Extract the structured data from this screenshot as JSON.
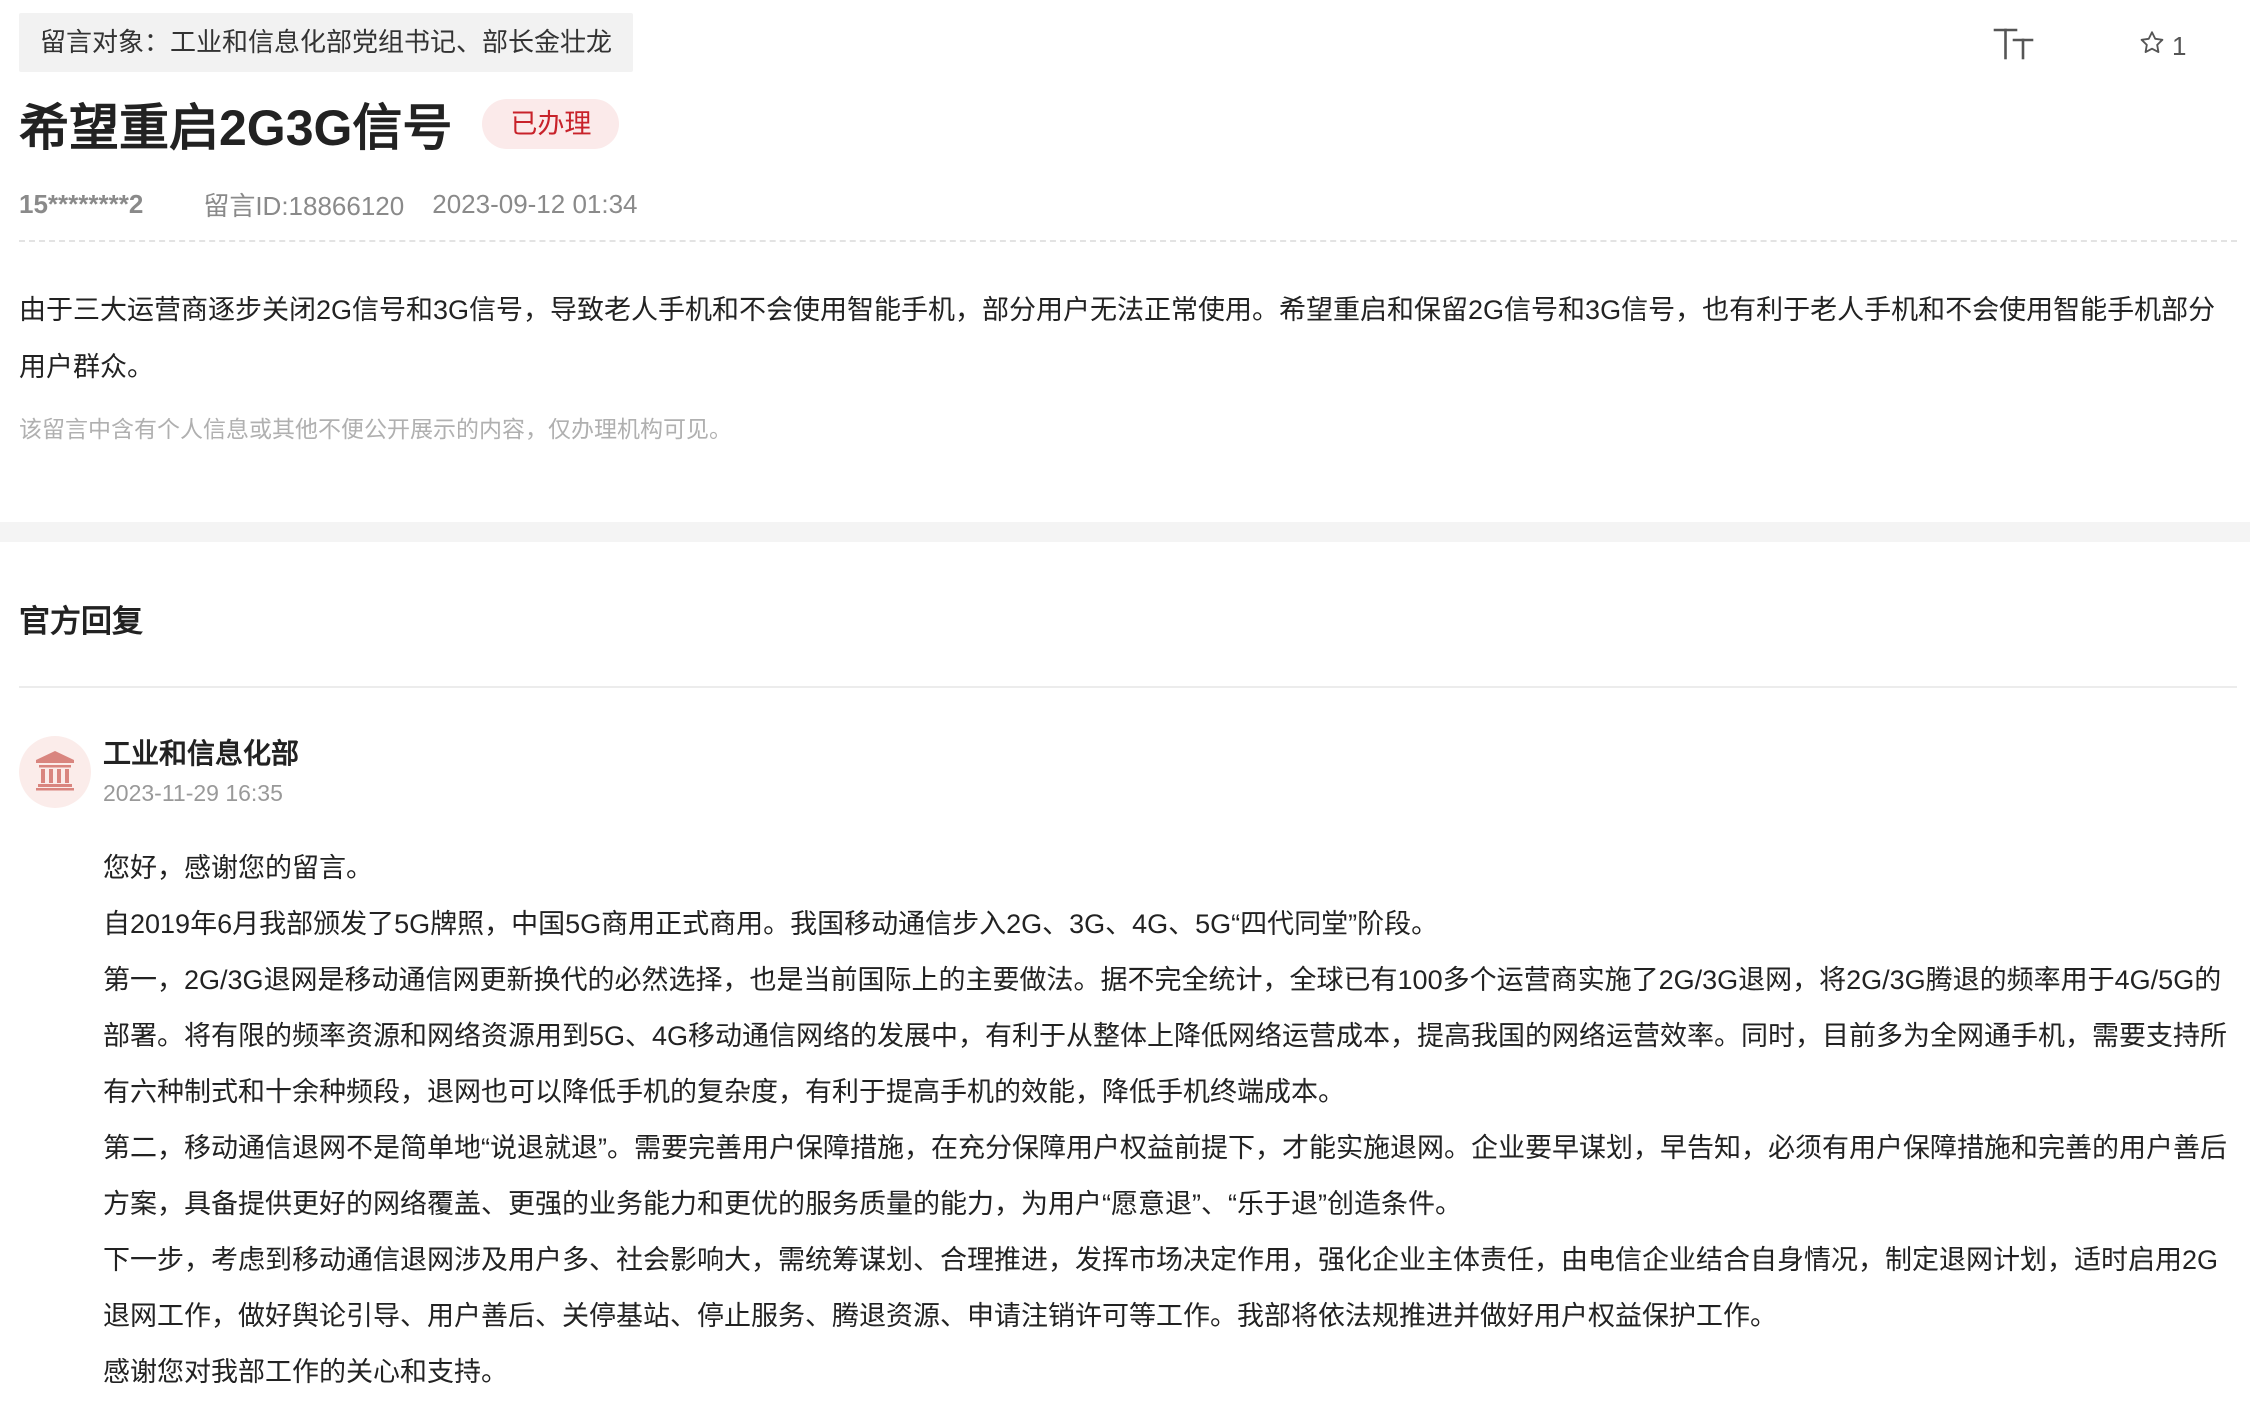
{
  "message": {
    "recipient_label": "留言对象：工业和信息化部党组书记、部长金壮龙",
    "title": "希望重启2G3G信号",
    "status": "已办理",
    "favorite_count": "1",
    "user": "15********2",
    "message_id": "留言ID:18866120",
    "date": "2023-09-12 01:34",
    "body": "由于三大运营商逐步关闭2G信号和3G信号，导致老人手机和不会使用智能手机，部分用户无法正常使用。希望重启和保留2G信号和3G信号，也有利于老人手机和不会使用智能手机部分用户群众。",
    "privacy_note": "该留言中含有个人信息或其他不便公开展示的内容，仅办理机构可见。"
  },
  "tools": {
    "font_size_icon": "font-size-icon",
    "favorite_icon": "star-icon"
  },
  "reply": {
    "heading": "官方回复",
    "org_icon": "government-building-icon",
    "org_name": "工业和信息化部",
    "date": "2023-11-29 16:35",
    "paragraphs": [
      "您好，感谢您的留言。",
      "自2019年6月我部颁发了5G牌照，中国5G商用正式商用。我国移动通信步入2G、3G、4G、5G“四代同堂”阶段。",
      "第一，2G/3G退网是移动通信网更新换代的必然选择，也是当前国际上的主要做法。据不完全统计，全球已有100多个运营商实施了2G/3G退网，将2G/3G腾退的频率用于4G/5G的部署。将有限的频率资源和网络资源用到5G、4G移动通信网络的发展中，有利于从整体上降低网络运营成本，提高我国的网络运营效率。同时，目前多为全网通手机，需要支持所有六种制式和十余种频段，退网也可以降低手机的复杂度，有利于提高手机的效能，降低手机终端成本。",
      "第二，移动通信退网不是简单地“说退就退”。需要完善用户保障措施，在充分保障用户权益前提下，才能实施退网。企业要早谋划，早告知，必须有用户保障措施和完善的用户善后方案，具备提供更好的网络覆盖、更强的业务能力和更优的服务质量的能力，为用户“愿意退”、“乐于退”创造条件。",
      "下一步，考虑到移动通信退网涉及用户多、社会影响大，需统筹谋划、合理推进，发挥市场决定作用，强化企业主体责任，由电信企业结合自身情况，制定退网计划，适时启用2G退网工作，做好舆论引导、用户善后、关停基站、停止服务、腾退资源、申请注销许可等工作。我部将依法规推进并做好用户权益保护工作。",
      "感谢您对我部工作的关心和支持。"
    ]
  },
  "colors": {
    "badge_bg": "#fbeaea",
    "badge_text": "#c8222a",
    "avatar_bg": "#fbecea",
    "avatar_icon": "#d9857f"
  }
}
